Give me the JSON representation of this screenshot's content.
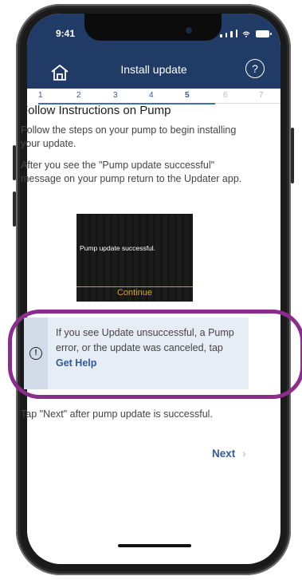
{
  "status_bar": {
    "time": "9:41"
  },
  "nav": {
    "title": "Install update",
    "help_label": "?"
  },
  "steps": [
    {
      "label": "1",
      "state": "done"
    },
    {
      "label": "2",
      "state": "done"
    },
    {
      "label": "3",
      "state": "done"
    },
    {
      "label": "4",
      "state": "done"
    },
    {
      "label": "5",
      "state": "current"
    },
    {
      "label": "6",
      "state": "future"
    },
    {
      "label": "7",
      "state": "future"
    }
  ],
  "content": {
    "heading": "Follow Instructions on Pump",
    "paragraph1": "Follow the steps on your pump to begin installing your update.",
    "paragraph2": "After you see the \"Pump update successful\" message on your pump return to the Updater app."
  },
  "pump_screen": {
    "message": "Pump update successful.",
    "continue_label": "Continue"
  },
  "info_box": {
    "text": "If you see Update unsuccessful, a Pump error, or the update was canceled, tap",
    "link_label": "Get Help",
    "icon": "info-exclamation-icon"
  },
  "footer": {
    "text": "Tap \"Next\" after pump update is successful.",
    "next_label": "Next",
    "next_chevron": "›"
  },
  "colors": {
    "header": "#1f3b66",
    "accent": "#2f5a9e",
    "highlight_ring": "#8a2d8b",
    "pump_continue": "#d9a619"
  }
}
